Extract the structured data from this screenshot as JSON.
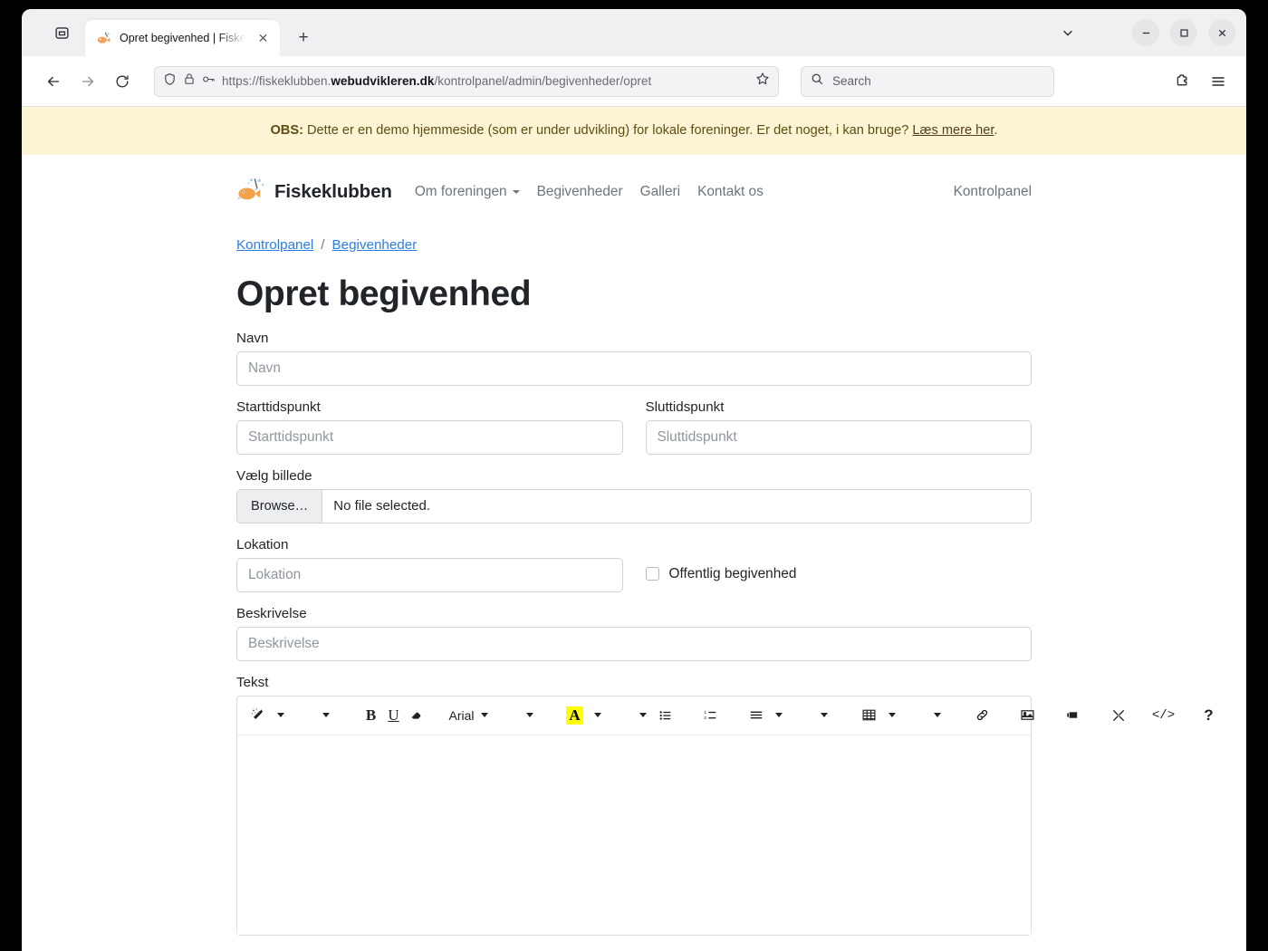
{
  "browser": {
    "tab": {
      "title": "Opret begivenhed | Fiske",
      "favicon_icon": "fish-favicon",
      "close_icon": "close-icon"
    },
    "new_tab_label": "+",
    "list_all_tabs_icon": "chevron-down-icon",
    "firefox_view_icon": "firefox-view-icon",
    "window_controls": {
      "minimize": "minimize-icon",
      "maximize": "maximize-icon",
      "close": "close-icon"
    },
    "toolbar": {
      "back_icon": "back-arrow-icon",
      "forward_icon": "forward-arrow-icon",
      "reload_icon": "reload-icon",
      "shield_icon": "shield-icon",
      "lock_icon": "lock-icon",
      "permissions_icon": "key-icon",
      "bookmark_icon": "star-icon",
      "extensions_icon": "extensions-icon",
      "menu_icon": "hamburger-menu-icon"
    },
    "url": {
      "prefix": "https://fiskeklubben.",
      "domain": "webudvikleren.dk",
      "path": "/kontrolpanel/admin/begivenheder/opret"
    },
    "search": {
      "placeholder": "Search",
      "icon": "search-icon"
    }
  },
  "alert": {
    "strong": "OBS:",
    "text": " Dette er en demo hjemmeside (som er under udvikling) for lokale foreninger. Er det noget, i kan bruge? ",
    "link": "Læs mere her",
    "suffix": "."
  },
  "site": {
    "brand": "Fiskeklubben",
    "brand_icon": "fish-logo-icon",
    "nav": [
      {
        "label": "Om foreningen",
        "has_caret": true
      },
      {
        "label": "Begivenheder",
        "has_caret": false
      },
      {
        "label": "Galleri",
        "has_caret": false
      },
      {
        "label": "Kontakt os",
        "has_caret": false
      }
    ],
    "nav_right": "Kontrolpanel"
  },
  "breadcrumb": {
    "first": "Kontrolpanel",
    "separator": "/",
    "second": "Begivenheder"
  },
  "page": {
    "title": "Opret begivenhed"
  },
  "form": {
    "navn": {
      "label": "Navn",
      "placeholder": "Navn",
      "value": ""
    },
    "start": {
      "label": "Starttidspunkt",
      "placeholder": "Starttidspunkt",
      "value": ""
    },
    "slut": {
      "label": "Sluttidspunkt",
      "placeholder": "Sluttidspunkt",
      "value": ""
    },
    "billede": {
      "label": "Vælg billede",
      "button": "Browse…",
      "status": "No file selected."
    },
    "lokation": {
      "label": "Lokation",
      "placeholder": "Lokation",
      "value": ""
    },
    "offentlig": {
      "label": "Offentlig begivenhed",
      "checked": false
    },
    "beskrivelse": {
      "label": "Beskrivelse",
      "placeholder": "Beskrivelse",
      "value": ""
    },
    "tekst": {
      "label": "Tekst",
      "content": ""
    }
  },
  "editor_toolbar": {
    "font_name": "Arial",
    "bold": "B",
    "underline": "U",
    "highlight_letter": "A",
    "code_view": "</>",
    "help": "?",
    "items": [
      "magic-wand-icon",
      "chevron-down-icon",
      "chevron-down-icon",
      "bold-icon",
      "underline-icon",
      "eraser-icon",
      "font-name-dropdown",
      "chevron-down-icon",
      "font-color-icon",
      "chevron-down-icon",
      "unordered-list-icon",
      "chevron-down-icon",
      "ordered-list-icon",
      "align-icon",
      "chevron-down-icon",
      "chevron-down-icon",
      "table-icon",
      "chevron-down-icon",
      "chevron-down-icon",
      "link-icon",
      "image-icon",
      "video-icon",
      "fullscreen-icon",
      "code-view-icon",
      "help-icon"
    ]
  },
  "colors": {
    "alert_bg": "#fcf4d4",
    "link": "#2b7de9",
    "muted": "#6c757d",
    "highlight": "#ffff00",
    "border": "#ced4da"
  }
}
